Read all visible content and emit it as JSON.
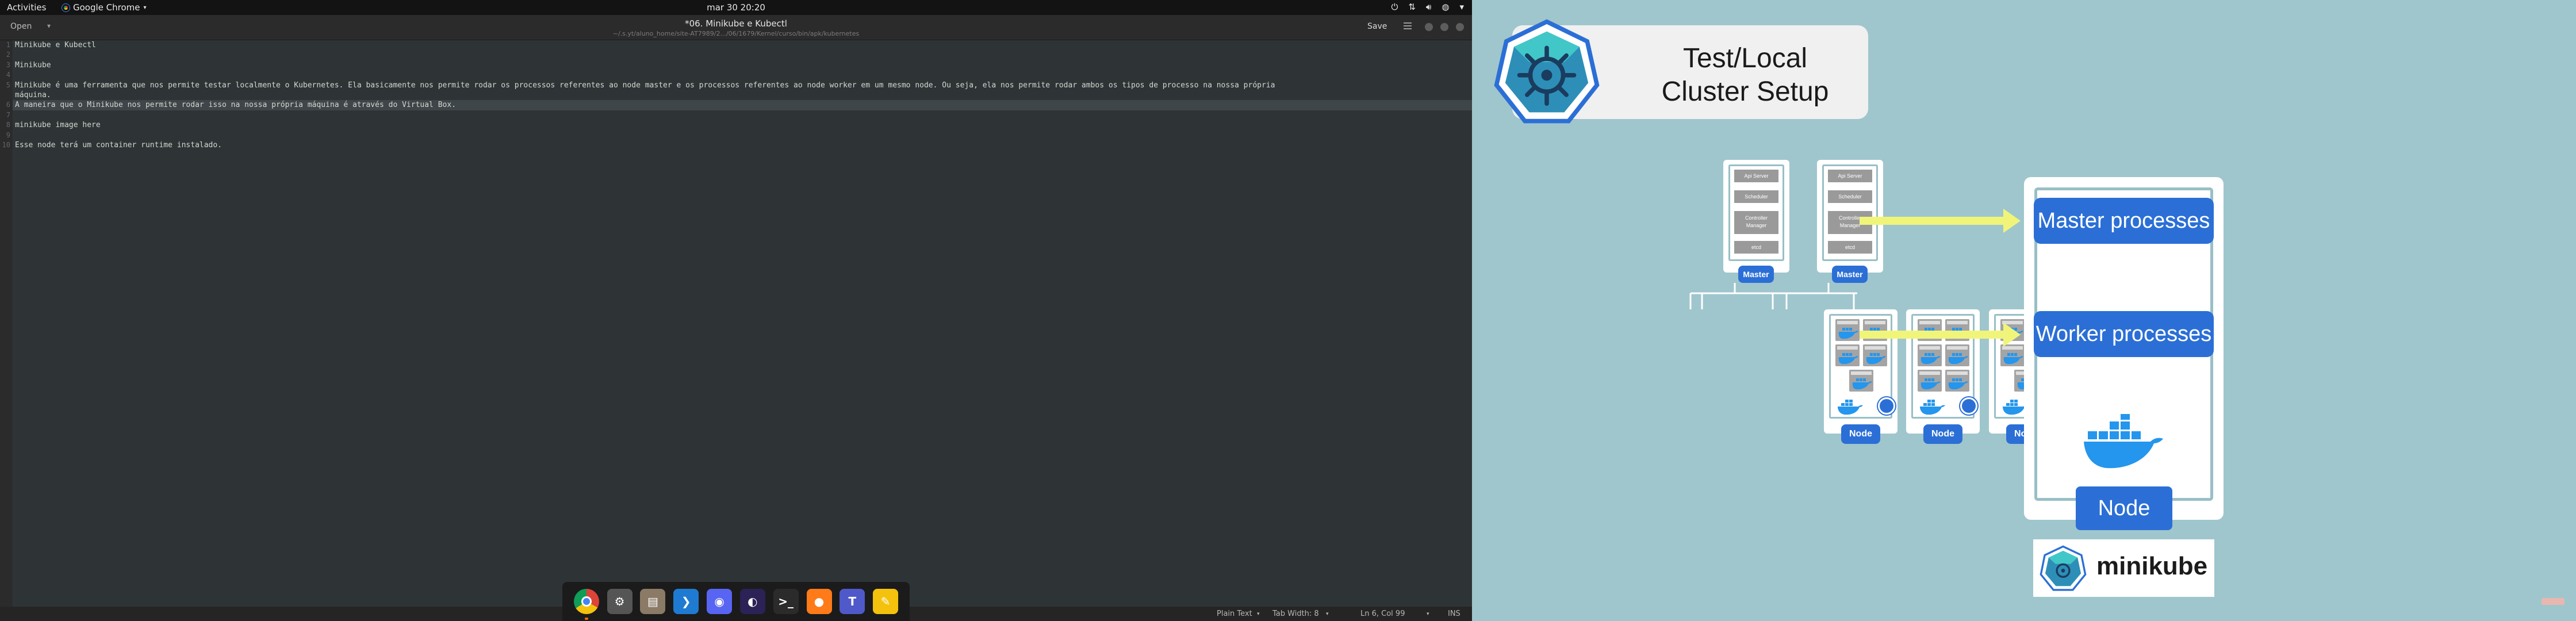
{
  "topbar": {
    "activities": "Activities",
    "app_name": "Google Chrome",
    "clock": "mar 30  20:20"
  },
  "gedit": {
    "open_label": "Open",
    "save_label": "Save",
    "doc_title": "*06. Minikube e Kubectl",
    "doc_path": "~/.s.yt/aluno_home/site-AT7989/2.../06/1679/Kernel/curso/bin/apk/kubernetes"
  },
  "editor": {
    "line_numbers": [
      "1",
      "2",
      "3",
      "4",
      "5",
      "6",
      "7",
      "8",
      "9",
      "10"
    ],
    "lines": [
      "Minikube e Kubectl",
      "",
      "Minikube",
      "",
      "Minikube é uma ferramenta que nos permite testar localmente o Kubernetes. Ela basicamente nos permite rodar os processos referentes ao node master e os processos referentes ao node worker em um mesmo node. Ou seja, ela nos permite rodar ambos os tipos de processo na nossa própria",
      "máquina.",
      "A maneira que o Minikube nos permite rodar isso na nossa própria máquina é através do Virtual Box.",
      "",
      "minikube image here",
      "",
      "Esse node terá um container runtime instalado."
    ],
    "current_line_index": 6
  },
  "statusbar": {
    "language": "Plain Text",
    "tab_width": "Tab Width: 8",
    "position": "Ln 6, Col 99",
    "mode": "INS"
  },
  "dock": {
    "apps": [
      {
        "name": "chrome-icon",
        "glyph": "",
        "color": "#db4437"
      },
      {
        "name": "settings-icon",
        "glyph": "⚙",
        "color": "#555555"
      },
      {
        "name": "files-icon",
        "glyph": "▤",
        "color": "#8a7a66"
      },
      {
        "name": "vscode-icon",
        "glyph": "❯",
        "color": "#1f7bd1"
      },
      {
        "name": "discord-icon",
        "glyph": "◉",
        "color": "#5865f2"
      },
      {
        "name": "eclipse-icon",
        "glyph": "◐",
        "color": "#2c2255"
      },
      {
        "name": "terminal-icon",
        "glyph": ">_",
        "color": "#2b2b2b"
      },
      {
        "name": "firefox-icon",
        "glyph": "●",
        "color": "#ff7a18"
      },
      {
        "name": "teams-icon",
        "glyph": "T",
        "color": "#5059c9"
      },
      {
        "name": "notes-icon",
        "glyph": "✎",
        "color": "#f4c20d"
      }
    ]
  },
  "slide": {
    "title_line1": "Test/Local",
    "title_line2": "Cluster Setup",
    "master_components": [
      "Api Server",
      "Scheduler",
      "Controller Manager",
      "etcd"
    ],
    "master_label": "Master",
    "node_label": "Node",
    "master_processes": "Master processes",
    "worker_processes": "Worker processes",
    "big_node_label": "Node",
    "minikube": "minikube",
    "colors": {
      "background": "#9fc6cc",
      "pill": "#2b6fd6",
      "arrow": "#f0f57a",
      "docker": "#2496ed"
    }
  }
}
